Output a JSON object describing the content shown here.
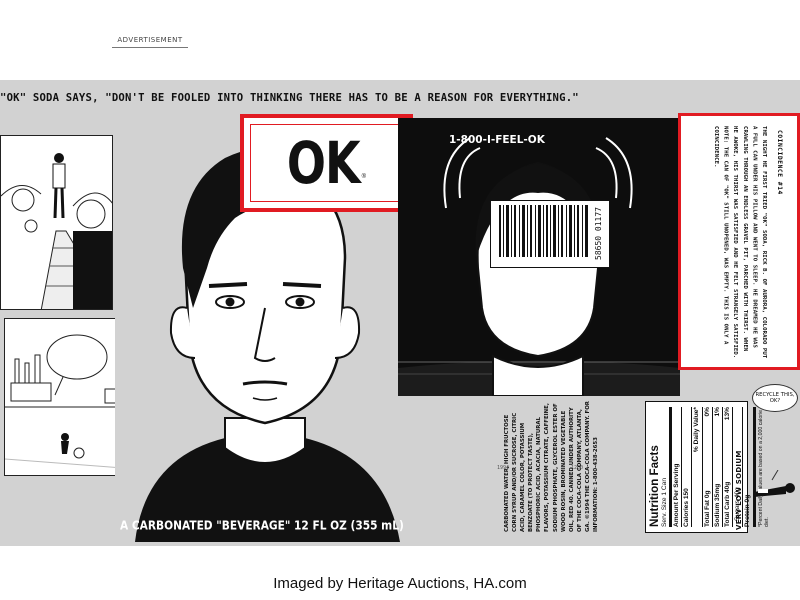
{
  "advertisement_label": "ADVERTISEMENT",
  "slogan": "\"OK\" SODA SAYS, \"DON'T BE FOOLED INTO THINKING THERE HAS TO BE A REASON FOR EVERYTHING.\"",
  "logo": {
    "text": "OK",
    "mark": "®"
  },
  "phone_number": "1-800-I-FEEL-OK",
  "barcode": {
    "number": "58650 01177",
    "small_left": "1994",
    "small_right": "1280"
  },
  "caption": "A CARBONATED \"BEVERAGE\"   12 FL OZ (355 mL)",
  "story": {
    "title": "COINCIDENCE #14",
    "text": "THE NIGHT HE FIRST TRIED \"OK\" SODA, RICK B. OF AURORA, COLORADO PUT A FULL CAN UNDER HIS PILLOW AND WENT TO SLEEP. HE DREAMED HE WAS CRAWLING THROUGH AN ENDLESS GRAVEL PIT, PARCHED WITH THIRST. WHEN HE AWOKE, HIS THIRST WAS SATISFIED AND HE FELT STRANGELY SATISFIED. NOTE: THE CAN OF \"OK\" STILL UNOPENED, WAS EMPTY. THIS IS ONLY A COINCIDENCE."
  },
  "nutrition": {
    "title": "Nutrition Facts",
    "serving": "Serv. Size 1 Can",
    "amount_per_serving": "Amount Per Serving",
    "calories": "Calories 150",
    "daily_value_header": "% Daily Value*",
    "rows": [
      {
        "label": "Total Fat 0g",
        "value": "0%"
      },
      {
        "label": "Sodium 35mg",
        "value": "1%"
      },
      {
        "label": "Total Carb 40g",
        "value": "13%"
      },
      {
        "label": "Sugars 40g",
        "value": ""
      },
      {
        "label": "Protein 0g",
        "value": ""
      }
    ],
    "footnote": "*Percent Daily Values are based on a 2,000 calorie diet."
  },
  "ingredients": "CARBONATED WATER, HIGH FRUCTOSE CORN SYRUP AND/OR SUCROSE, CITRIC ACID, CARAMEL COLOR, POTASSIUM BENZOATE (TO PROTECT TASTE), PHOSPHORIC ACID, ACACIA, NATURAL FLAVORS, POTASSIUM CITRATE, CAFFEINE, SODIUM PHOSPHATE, GLYCEROL ESTER OF WOOD ROSIN, BROMINATED VEGETABLE OIL, RED 40. CANNED UNDER AUTHORITY OF THE COCA-COLA COMPANY, ATLANTA, GA. ©1994 THE COCA-COLA COMPANY. FOR INFORMATION: 1-800-438-2653",
  "very_low_sodium": "VERY LOW SODIUM",
  "recycle_bubble": "RECYCLE THIS, OK?",
  "credit": "Imaged by Heritage Auctions, HA.com",
  "colors": {
    "logo_red": "#e11b22",
    "can_gray": "#d2d2d2",
    "panel_black": "#0d0d0d"
  }
}
